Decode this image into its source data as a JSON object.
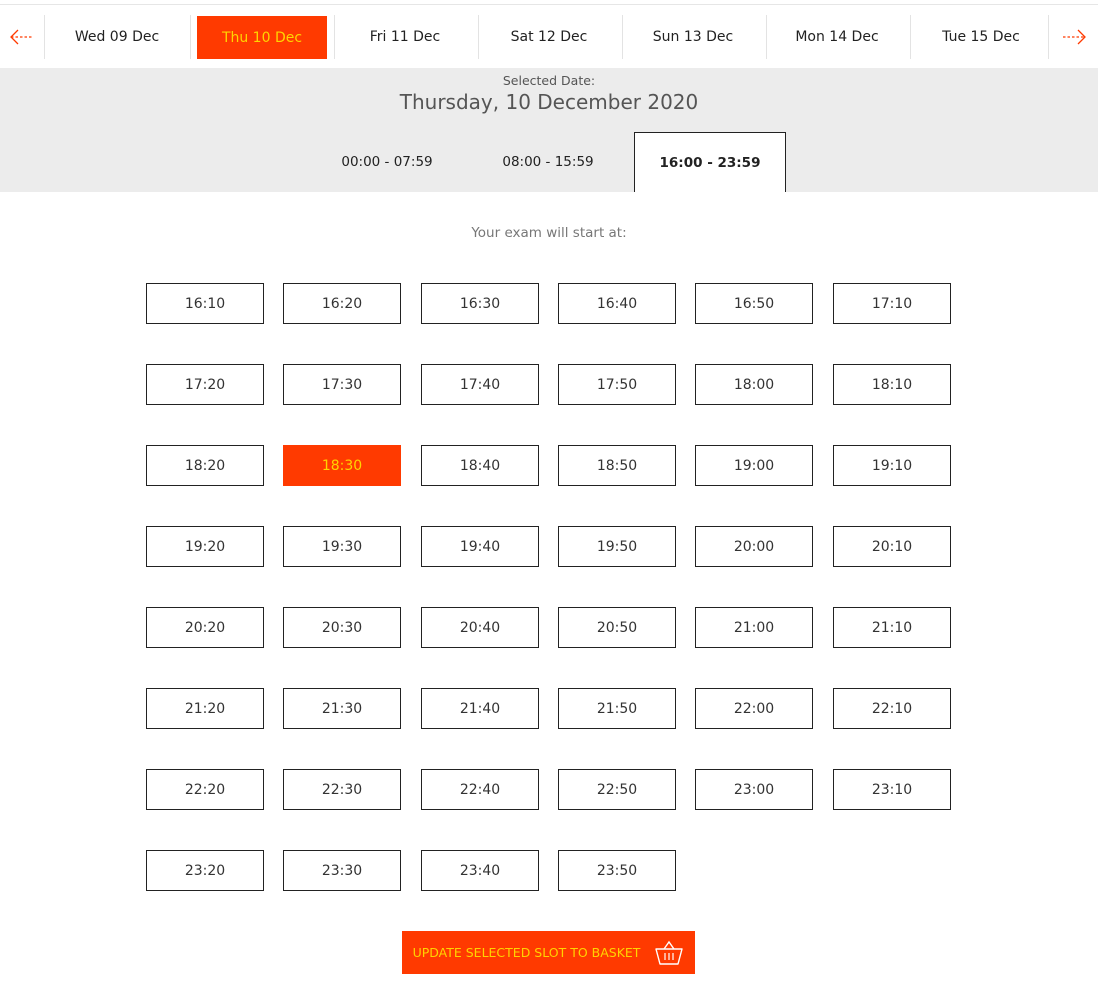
{
  "date_strip": {
    "days": [
      {
        "label": "Wed 09 Dec"
      },
      {
        "label": "Thu 10 Dec",
        "selected": true
      },
      {
        "label": "Fri 11 Dec"
      },
      {
        "label": "Sat 12 Dec"
      },
      {
        "label": "Sun 13 Dec"
      },
      {
        "label": "Mon 14 Dec"
      },
      {
        "label": "Tue 15 Dec"
      }
    ],
    "prev_icon": "arrow-left-icon",
    "next_icon": "arrow-right-icon"
  },
  "date_panel": {
    "label": "Selected Date:",
    "date": "Thursday, 10 December 2020",
    "ranges": [
      {
        "label": "00:00 - 07:59"
      },
      {
        "label": "08:00 - 15:59"
      },
      {
        "label": "16:00 - 23:59",
        "active": true
      }
    ]
  },
  "slots": {
    "heading": "Your exam will start at:",
    "times": [
      "16:10",
      "16:20",
      "16:30",
      "16:40",
      "16:50",
      "17:10",
      "17:20",
      "17:30",
      "17:40",
      "17:50",
      "18:00",
      "18:10",
      "18:20",
      "18:30",
      "18:40",
      "18:50",
      "19:00",
      "19:10",
      "19:20",
      "19:30",
      "19:40",
      "19:50",
      "20:00",
      "20:10",
      "20:20",
      "20:30",
      "20:40",
      "20:50",
      "21:00",
      "21:10",
      "21:20",
      "21:30",
      "21:40",
      "21:50",
      "22:00",
      "22:10",
      "22:20",
      "22:30",
      "22:40",
      "22:50",
      "23:00",
      "23:10",
      "23:20",
      "23:30",
      "23:40",
      "23:50"
    ],
    "selected": "18:30"
  },
  "update_button": {
    "label": "UPDATE SELECTED SLOT TO BASKET",
    "icon": "basket-icon"
  },
  "colors": {
    "accent": "#ff3a00",
    "accent_text": "#ffd400",
    "panel_bg": "#ececec"
  }
}
